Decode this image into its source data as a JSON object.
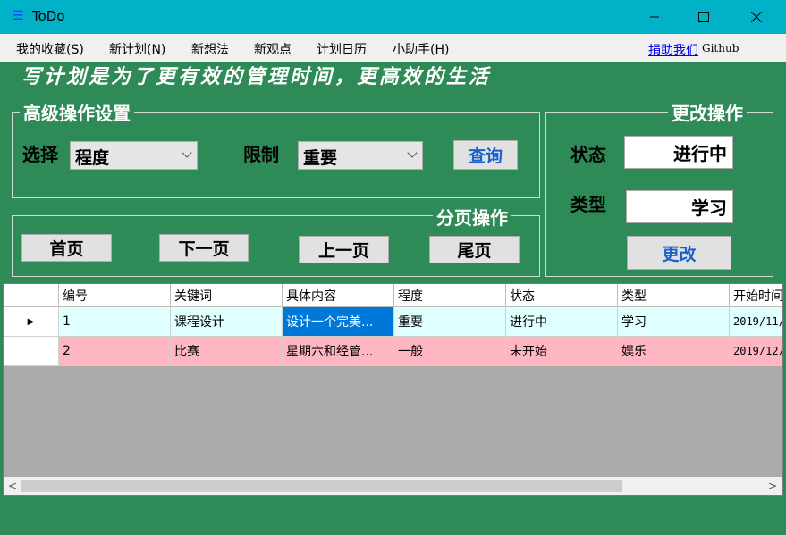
{
  "window": {
    "title": "ToDo",
    "minimize": "—",
    "maximize": "☐",
    "close": "✕"
  },
  "menu": {
    "items": [
      "我的收藏(S)",
      "新计划(N)",
      "新想法",
      "新观点",
      "计划日历",
      "小助手(H)"
    ],
    "donate_link": "捐助我们",
    "github_text": "Github"
  },
  "slogan": "写计划是为了更有效的管理时间，更高效的生活",
  "advanced": {
    "title": "高级操作设置",
    "select_label": "选择",
    "select_value": "程度",
    "limit_label": "限制",
    "limit_value": "重要",
    "query_button": "查询"
  },
  "paging": {
    "title": "分页操作",
    "first": "首页",
    "next": "下一页",
    "prev": "上一页",
    "last": "尾页"
  },
  "change": {
    "title": "更改操作",
    "status_label": "状态",
    "status_value": "进行中",
    "type_label": "类型",
    "type_value": "学习",
    "change_button": "更改"
  },
  "table": {
    "columns": [
      "编号",
      "关键词",
      "具体内容",
      "程度",
      "状态",
      "类型",
      "开始时间"
    ],
    "rows": [
      {
        "cells": [
          "1",
          "课程设计",
          "设计一个完美...",
          "重要",
          "进行中",
          "学习",
          "2019/11/"
        ],
        "bg": "#e0ffff"
      },
      {
        "cells": [
          "2",
          "比赛",
          "星期六和经管...",
          "一般",
          "未开始",
          "娱乐",
          "2019/12/"
        ],
        "bg": "#ffb6c1"
      }
    ],
    "current_row_marker": "▶"
  },
  "colors": {
    "background": "#2e8b57",
    "titlebar": "#00b1c8",
    "selection": "#0078d7"
  }
}
